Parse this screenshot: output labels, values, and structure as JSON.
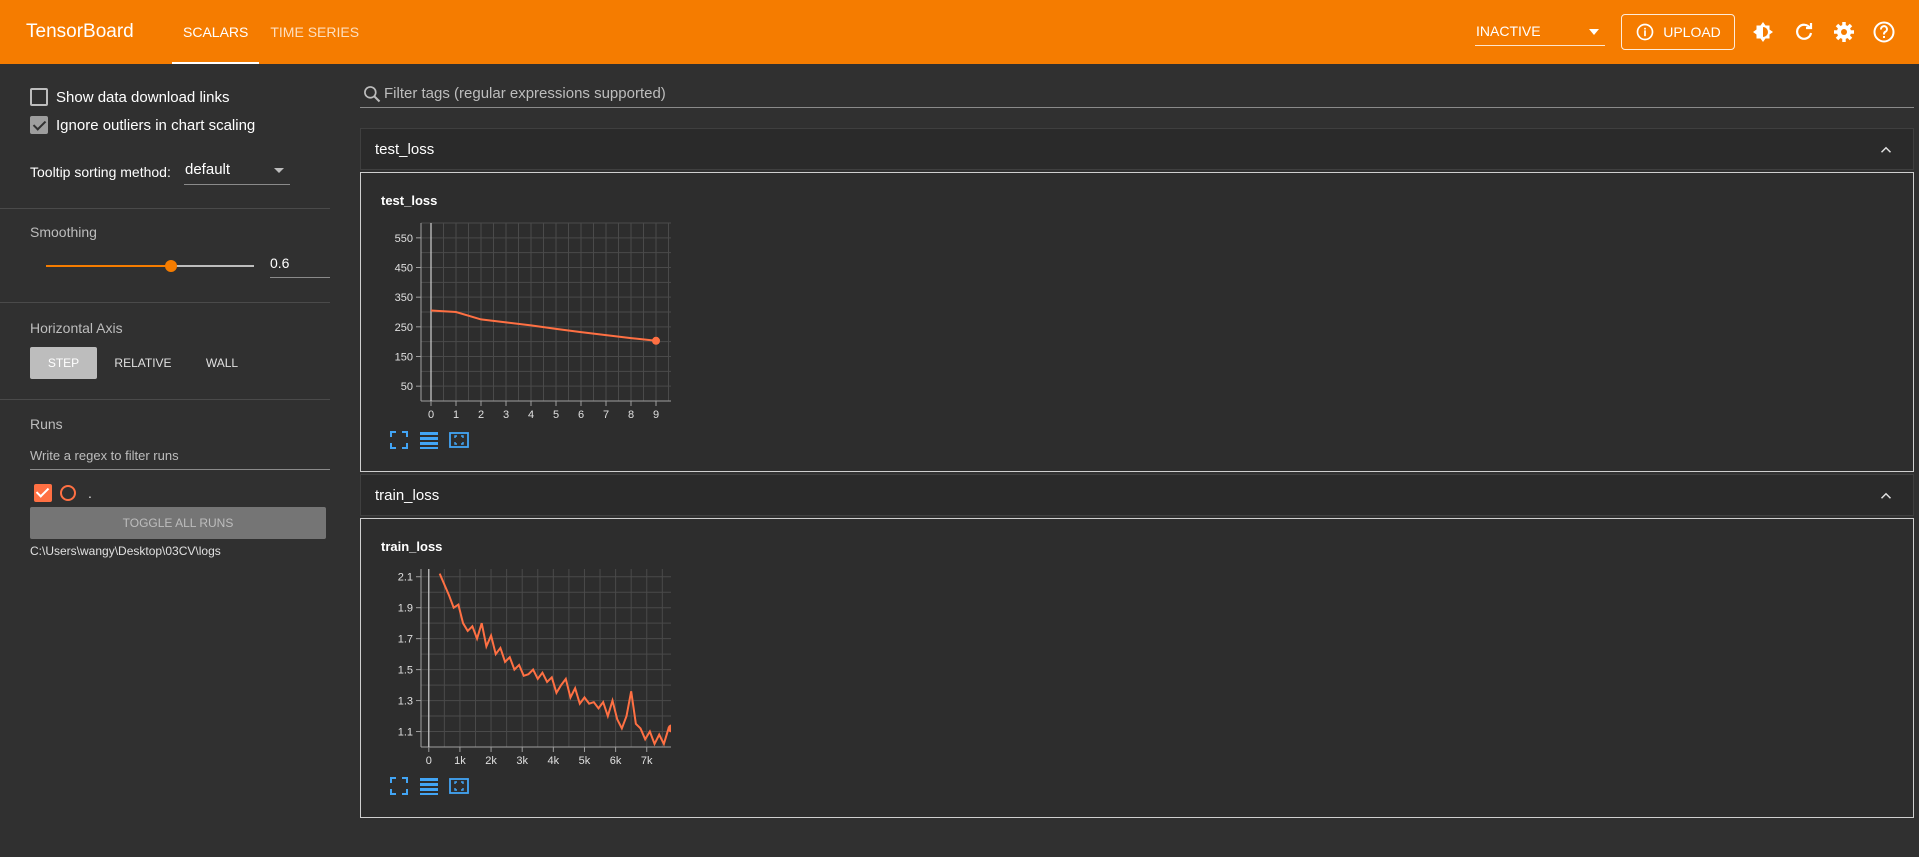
{
  "header": {
    "brand": "TensorBoard",
    "tabs": [
      {
        "label": "SCALARS",
        "active": true
      },
      {
        "label": "TIME SERIES",
        "active": false
      }
    ],
    "status_select": "INACTIVE",
    "upload_label": "UPLOAD",
    "icons": [
      "info-icon",
      "theme-icon",
      "refresh-icon",
      "settings-icon",
      "help-icon"
    ],
    "color": "#f57c00"
  },
  "sidebar": {
    "show_download_links": {
      "label": "Show data download links",
      "checked": false
    },
    "ignore_outliers": {
      "label": "Ignore outliers in chart scaling",
      "checked": true
    },
    "tooltip_sort": {
      "label": "Tooltip sorting method:",
      "value": "default"
    },
    "smoothing": {
      "label": "Smoothing",
      "value": "0.6",
      "fraction": 0.6
    },
    "horizontal_axis": {
      "label": "Horizontal Axis",
      "options": [
        "STEP",
        "RELATIVE",
        "WALL"
      ],
      "selected": "STEP"
    },
    "runs": {
      "label": "Runs",
      "filter_placeholder": "Write a regex to filter runs",
      "items": [
        {
          "name": ".",
          "checked": true,
          "color": "#ff7043"
        }
      ],
      "toggle_all_label": "TOGGLE ALL RUNS",
      "logdir": "C:\\Users\\wangy\\Desktop\\03CV\\logs"
    }
  },
  "main": {
    "filter_placeholder": "Filter tags (regular expressions supported)",
    "groups": [
      {
        "title": "test_loss",
        "card_title": "test_loss"
      },
      {
        "title": "train_loss",
        "card_title": "train_loss"
      }
    ]
  },
  "chart_data": [
    {
      "type": "line",
      "title": "test_loss",
      "color": "#ff7043",
      "x": [
        0,
        1,
        2,
        3,
        4,
        5,
        6,
        7,
        8,
        9
      ],
      "y": [
        305,
        300,
        275,
        265,
        255,
        243,
        232,
        222,
        212,
        203
      ],
      "xlim": [
        -0.4,
        10
      ],
      "ylim": [
        0,
        600
      ],
      "yticks": [
        50,
        150,
        250,
        350,
        450,
        550
      ],
      "xticks": [
        0,
        1,
        2,
        3,
        4,
        5,
        6,
        7,
        8,
        9
      ],
      "xtick_labels": [
        "0",
        "1",
        "2",
        "3",
        "4",
        "5",
        "6",
        "7",
        "8",
        "9"
      ],
      "grid": true
    },
    {
      "type": "line",
      "title": "train_loss",
      "color": "#ff7043",
      "x": [
        350,
        500,
        650,
        800,
        950,
        1100,
        1250,
        1400,
        1550,
        1700,
        1850,
        2000,
        2150,
        2300,
        2450,
        2600,
        2750,
        2900,
        3050,
        3200,
        3350,
        3500,
        3650,
        3800,
        3950,
        4100,
        4250,
        4400,
        4550,
        4700,
        4850,
        5000,
        5150,
        5300,
        5450,
        5600,
        5750,
        5900,
        6050,
        6200,
        6350,
        6500,
        6650,
        6800,
        6950,
        7100,
        7250,
        7400,
        7550,
        7700,
        7800
      ],
      "y": [
        2.12,
        2.05,
        1.98,
        1.9,
        1.92,
        1.8,
        1.75,
        1.78,
        1.7,
        1.8,
        1.65,
        1.72,
        1.6,
        1.64,
        1.55,
        1.58,
        1.5,
        1.53,
        1.46,
        1.47,
        1.5,
        1.44,
        1.48,
        1.42,
        1.45,
        1.35,
        1.4,
        1.44,
        1.32,
        1.38,
        1.28,
        1.32,
        1.28,
        1.29,
        1.25,
        1.29,
        1.2,
        1.3,
        1.18,
        1.12,
        1.2,
        1.36,
        1.15,
        1.12,
        1.05,
        1.1,
        1.02,
        1.08,
        1.02,
        1.12,
        1.12
      ],
      "xlim": [
        -250,
        8100
      ],
      "ylim": [
        1.0,
        2.15
      ],
      "yticks": [
        1.1,
        1.3,
        1.5,
        1.7,
        1.9,
        2.1
      ],
      "xticks": [
        0,
        1000,
        2000,
        3000,
        4000,
        5000,
        6000,
        7000
      ],
      "xtick_labels": [
        "0",
        "1k",
        "2k",
        "3k",
        "4k",
        "5k",
        "6k",
        "7k"
      ],
      "grid": true
    }
  ]
}
